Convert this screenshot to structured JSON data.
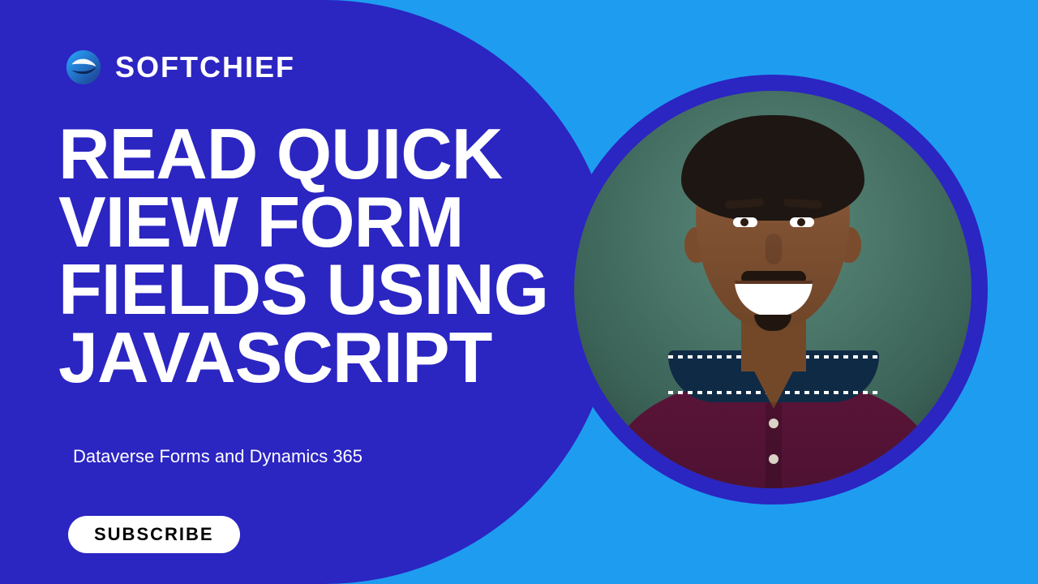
{
  "brand": {
    "name": "SOFTCHIEF"
  },
  "title": "READ QUICK\nVIEW FORM\nFIELDS USING\nJAVASCRIPT",
  "subtitle": "Dataverse Forms and Dynamics 365",
  "cta": {
    "subscribe_label": "SUBSCRIBE"
  },
  "colors": {
    "panel": "#2B25C2",
    "background": "#1E9DF0",
    "text": "#FFFFFF",
    "button_bg": "#FFFFFF",
    "button_text": "#000000"
  }
}
